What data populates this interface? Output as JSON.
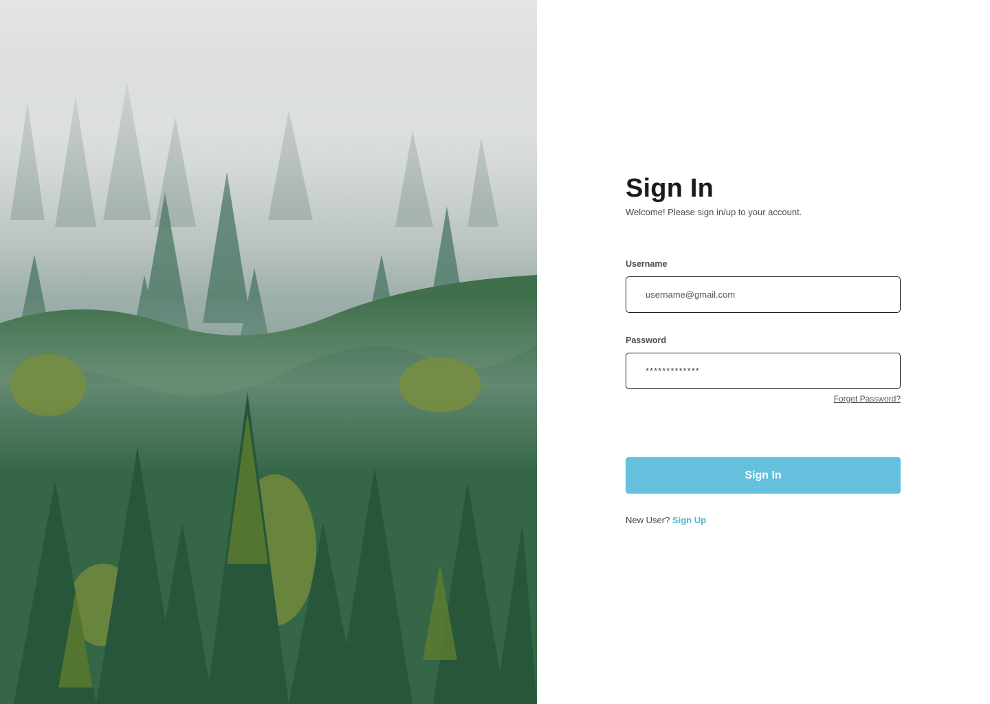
{
  "hero": {
    "image": "forest-in-fog-photo"
  },
  "form": {
    "title": "Sign In",
    "subtitle": "Welcome! Please sign in/up to your account.",
    "username": {
      "label": "Username",
      "placeholder": "username@gmail.com",
      "value": ""
    },
    "password": {
      "label": "Password",
      "value": "*************"
    },
    "forget_password": "Forget Password?",
    "submit_label": "Sign In",
    "new_user_text": "New User?",
    "signup_link": "Sign Up"
  },
  "colors": {
    "accent": "#64c0dc",
    "link": "#4fb6d6",
    "text_dark": "#1b1b1b"
  }
}
